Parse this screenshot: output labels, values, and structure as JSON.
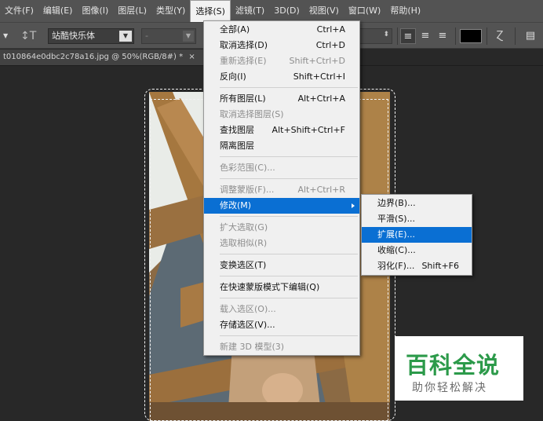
{
  "menubar": {
    "items": [
      "文件(F)",
      "编辑(E)",
      "图像(I)",
      "图层(L)",
      "类型(Y)",
      "选择(S)",
      "滤镜(T)",
      "3D(D)",
      "视图(V)",
      "窗口(W)",
      "帮助(H)"
    ]
  },
  "options": {
    "font_family": "站酷快乐体",
    "font_style": "-",
    "text_color": "#000000"
  },
  "document": {
    "tab_title": "t010864e0dbc2c78a16.jpg @ 50%(RGB/8#) *",
    "close": "×"
  },
  "select_menu": {
    "items": [
      {
        "label": "全部(A)",
        "shortcut": "Ctrl+A",
        "disabled": false
      },
      {
        "label": "取消选择(D)",
        "shortcut": "Ctrl+D",
        "disabled": false
      },
      {
        "label": "重新选择(E)",
        "shortcut": "Shift+Ctrl+D",
        "disabled": true
      },
      {
        "label": "反向(I)",
        "shortcut": "Shift+Ctrl+I",
        "disabled": false
      },
      {
        "label": "所有图层(L)",
        "shortcut": "Alt+Ctrl+A",
        "disabled": false
      },
      {
        "label": "取消选择图层(S)",
        "shortcut": "",
        "disabled": true
      },
      {
        "label": "查找图层",
        "shortcut": "Alt+Shift+Ctrl+F",
        "disabled": false
      },
      {
        "label": "隔离图层",
        "shortcut": "",
        "disabled": false
      },
      {
        "label": "色彩范围(C)...",
        "shortcut": "",
        "disabled": true
      },
      {
        "label": "调整蒙版(F)...",
        "shortcut": "Alt+Ctrl+R",
        "disabled": true
      },
      {
        "label": "修改(M)",
        "shortcut": "",
        "disabled": false,
        "highlighted": true
      },
      {
        "label": "扩大选取(G)",
        "shortcut": "",
        "disabled": true
      },
      {
        "label": "选取相似(R)",
        "shortcut": "",
        "disabled": true
      },
      {
        "label": "变换选区(T)",
        "shortcut": "",
        "disabled": false
      },
      {
        "label": "在快速蒙版模式下编辑(Q)",
        "shortcut": "",
        "disabled": false
      },
      {
        "label": "载入选区(O)...",
        "shortcut": "",
        "disabled": true
      },
      {
        "label": "存储选区(V)...",
        "shortcut": "",
        "disabled": false
      },
      {
        "label": "新建 3D 模型(3)",
        "shortcut": "",
        "disabled": true
      }
    ]
  },
  "modify_submenu": {
    "items": [
      {
        "label": "边界(B)...",
        "shortcut": ""
      },
      {
        "label": "平滑(S)...",
        "shortcut": ""
      },
      {
        "label": "扩展(E)...",
        "shortcut": "",
        "highlighted": true
      },
      {
        "label": "收缩(C)...",
        "shortcut": ""
      },
      {
        "label": "羽化(F)...",
        "shortcut": "Shift+F6"
      }
    ]
  },
  "watermark": {
    "title": "百科全说",
    "subtitle": "助你轻松解决"
  },
  "colors": {
    "menu_highlight": "#0a6fd3",
    "watermark_green": "#2c9a4a"
  }
}
